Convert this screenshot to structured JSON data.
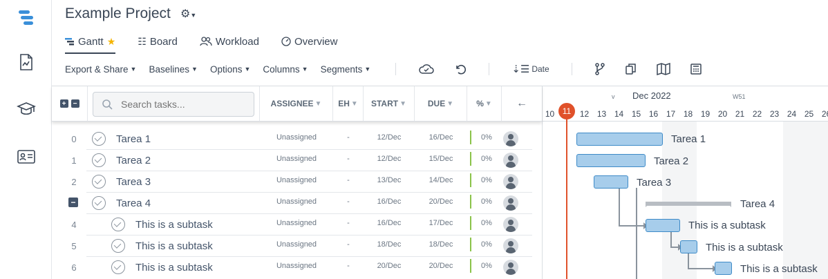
{
  "project": {
    "title": "Example Project"
  },
  "tabs": [
    {
      "label": "Gantt",
      "active": true
    },
    {
      "label": "Board"
    },
    {
      "label": "Workload"
    },
    {
      "label": "Overview"
    }
  ],
  "toolbar": {
    "export": "Export & Share",
    "baselines": "Baselines",
    "options": "Options",
    "columns": "Columns",
    "segments": "Segments",
    "date": "Date"
  },
  "grid": {
    "search_placeholder": "Search tasks...",
    "columns": {
      "assignee": "ASSIGNEE",
      "eh": "EH",
      "start": "START",
      "due": "DUE",
      "pct": "%"
    }
  },
  "rows": [
    {
      "num": "0",
      "name": "Tarea 1",
      "assignee": "Unassigned",
      "eh": "-",
      "start": "12/Dec",
      "due": "16/Dec",
      "pct": "0%"
    },
    {
      "num": "1",
      "name": "Tarea 2",
      "assignee": "Unassigned",
      "eh": "-",
      "start": "12/Dec",
      "due": "15/Dec",
      "pct": "0%"
    },
    {
      "num": "2",
      "name": "Tarea 3",
      "assignee": "Unassigned",
      "eh": "-",
      "start": "13/Dec",
      "due": "14/Dec",
      "pct": "0%"
    },
    {
      "num": "",
      "name": "Tarea 4",
      "assignee": "Unassigned",
      "eh": "-",
      "start": "16/Dec",
      "due": "20/Dec",
      "pct": "0%"
    },
    {
      "num": "4",
      "name": "This is a subtask",
      "assignee": "Unassigned",
      "eh": "-",
      "start": "16/Dec",
      "due": "17/Dec",
      "pct": "0%"
    },
    {
      "num": "5",
      "name": "This is a subtask",
      "assignee": "Unassigned",
      "eh": "-",
      "start": "18/Dec",
      "due": "18/Dec",
      "pct": "0%"
    },
    {
      "num": "6",
      "name": "This is a subtask",
      "assignee": "Unassigned",
      "eh": "-",
      "start": "20/Dec",
      "due": "20/Dec",
      "pct": "0%"
    }
  ],
  "timeline": {
    "month": "Dec 2022",
    "week": "W51",
    "v_marker": "v",
    "today": "11",
    "days": [
      "10",
      "12",
      "13",
      "14",
      "15",
      "16",
      "17",
      "18",
      "19",
      "20",
      "21",
      "22",
      "23",
      "24",
      "25",
      "26"
    ],
    "labels": [
      "Tarea 1",
      "Tarea 2",
      "Tarea 3",
      "Tarea 4",
      "This is a subtask",
      "This is a subtask",
      "This is a subtask"
    ]
  },
  "colors": {
    "accent": "#e0512a",
    "bar": "#a7cdeb",
    "bar_border": "#3d8ac7",
    "progress": "#8bc34a"
  }
}
